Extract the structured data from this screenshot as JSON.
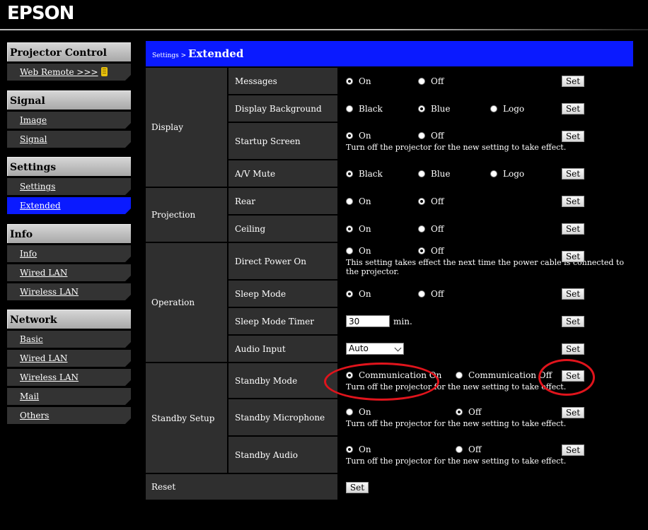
{
  "header": {
    "logo": "EPSON"
  },
  "sidebar": {
    "groups": [
      {
        "title": "Projector Control",
        "items": [
          {
            "label": "Web Remote >>>"
          }
        ]
      },
      {
        "title": "Signal",
        "items": [
          {
            "label": "Image"
          },
          {
            "label": "Signal"
          }
        ]
      },
      {
        "title": "Settings",
        "items": [
          {
            "label": "Settings"
          },
          {
            "label": "Extended"
          }
        ]
      },
      {
        "title": "Info",
        "items": [
          {
            "label": "Info"
          },
          {
            "label": "Wired LAN"
          },
          {
            "label": "Wireless LAN"
          }
        ]
      },
      {
        "title": "Network",
        "items": [
          {
            "label": "Basic"
          },
          {
            "label": "Wired LAN"
          },
          {
            "label": "Wireless LAN"
          },
          {
            "label": "Mail"
          },
          {
            "label": "Others"
          }
        ]
      }
    ],
    "active_item": "Extended"
  },
  "title_bar": {
    "crumb": "Settings > ",
    "page": "Extended"
  },
  "set_label": "Set",
  "categories": [
    "Display",
    "Projection",
    "Operation",
    "Standby Setup",
    "Reset"
  ],
  "rows": [
    {
      "name": "Messages",
      "options": [
        "On",
        "Off"
      ],
      "selected": "On"
    },
    {
      "name": "Display Background",
      "options": [
        "Black",
        "Blue",
        "Logo"
      ],
      "selected": "Blue"
    },
    {
      "name": "Startup Screen",
      "options": [
        "On",
        "Off"
      ],
      "selected": "On",
      "note": "Turn off the projector for the new setting to take effect."
    },
    {
      "name": "A/V Mute",
      "options": [
        "Black",
        "Blue",
        "Logo"
      ],
      "selected": "Black"
    },
    {
      "name": "Rear",
      "options": [
        "On",
        "Off"
      ],
      "selected": "Off"
    },
    {
      "name": "Ceiling",
      "options": [
        "On",
        "Off"
      ],
      "selected": "On"
    },
    {
      "name": "Direct Power On",
      "options": [
        "On",
        "Off"
      ],
      "selected": "Off",
      "note": "This setting takes effect the next time the power cable is connected to the projector."
    },
    {
      "name": "Sleep Mode",
      "options": [
        "On",
        "Off"
      ],
      "selected": "On"
    },
    {
      "name": "Sleep Mode Timer",
      "value": "30",
      "unit": "min."
    },
    {
      "name": "Audio Input",
      "value": "Auto"
    },
    {
      "name": "Standby Mode",
      "options": [
        "Communication On",
        "Communication Off"
      ],
      "selected": "Communication On",
      "note": "Turn off the projector for the new setting to take effect."
    },
    {
      "name": "Standby Microphone",
      "options": [
        "On",
        "Off"
      ],
      "selected": "Off",
      "note": "Turn off the projector for the new setting to take effect."
    },
    {
      "name": "Standby Audio",
      "options": [
        "On",
        "Off"
      ],
      "selected": "On",
      "note": "Turn off the projector for the new setting to take effect."
    }
  ],
  "reset": {
    "label": "Reset",
    "button": "Set"
  },
  "annotation_color": "#e0141c"
}
